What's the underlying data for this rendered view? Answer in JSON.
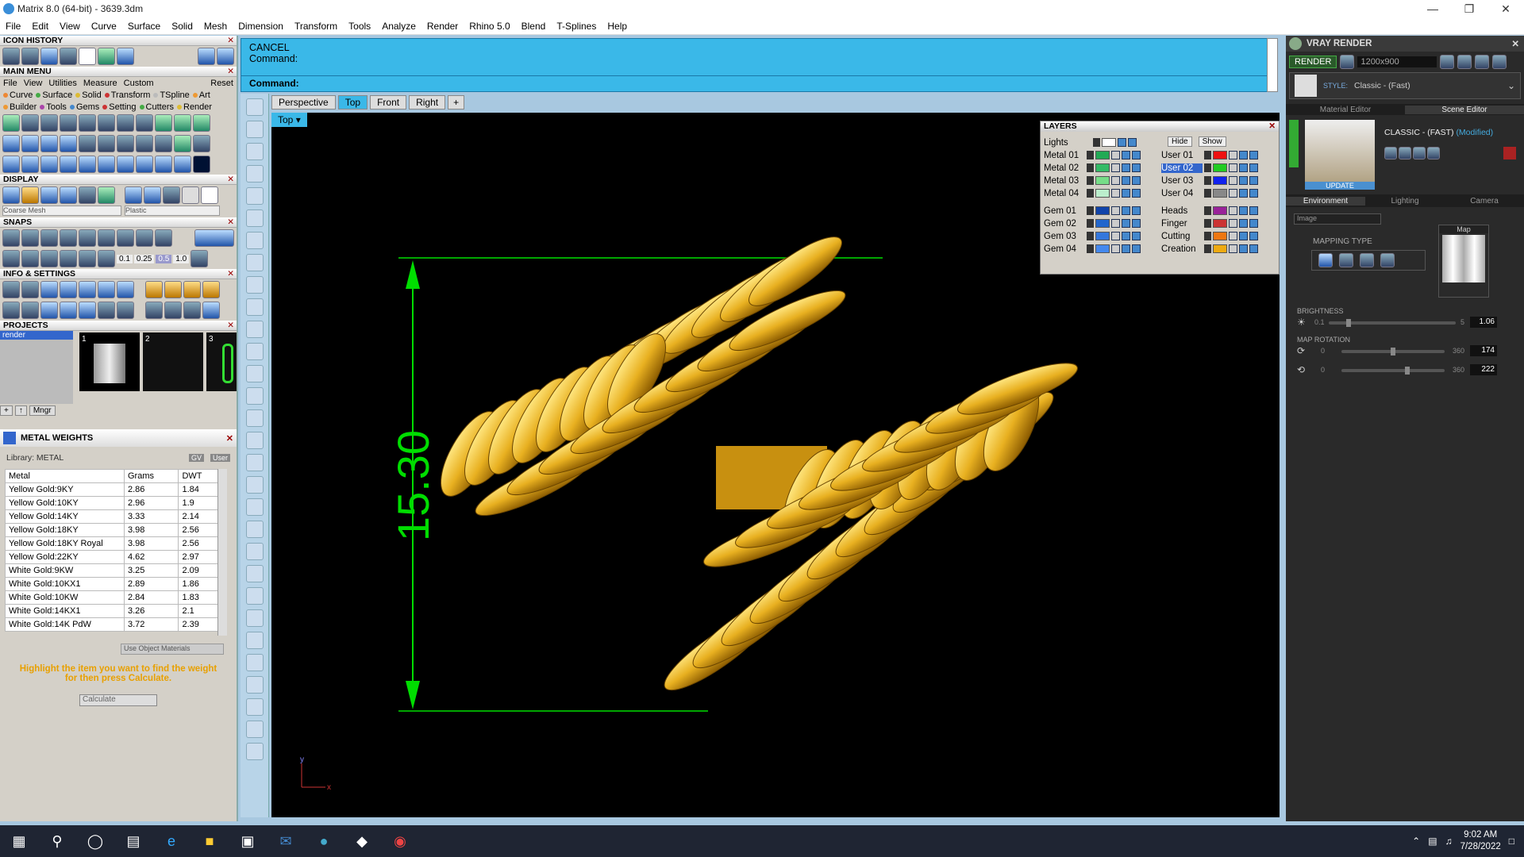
{
  "window": {
    "title": "Matrix 8.0 (64-bit) - 3639.3dm"
  },
  "menu": [
    "File",
    "Edit",
    "View",
    "Curve",
    "Surface",
    "Solid",
    "Mesh",
    "Dimension",
    "Transform",
    "Tools",
    "Analyze",
    "Render",
    "Rhino 5.0",
    "Blend",
    "T-Splines",
    "Help"
  ],
  "left": {
    "icon_history": "ICON HISTORY",
    "main_menu": "MAIN MENU",
    "mm_row1": [
      "File",
      "View",
      "Utilities",
      "Measure",
      "Custom",
      "Reset"
    ],
    "mm_row2": [
      "Curve",
      "Surface",
      "Solid",
      "Transform",
      "TSpline",
      "Art"
    ],
    "mm_row3": [
      "Builder",
      "Tools",
      "Gems",
      "Setting",
      "Cutters",
      "Render"
    ],
    "display": "DISPLAY",
    "display_left": "Coarse Mesh",
    "display_right": "Plastic",
    "snaps": "SNAPS",
    "snap_values": [
      "0.1",
      "0.25",
      "0.5",
      "1.0"
    ],
    "info": "INFO & SETTINGS",
    "projects": "PROJECTS",
    "project_item": "render",
    "project_nums": [
      "1",
      "2",
      "3"
    ],
    "mngr": "Mngr",
    "metal_weights": "METAL WEIGHTS",
    "library": "Library: METAL",
    "gv": "GV",
    "user": "User",
    "table_headers": [
      "Metal",
      "Grams",
      "DWT"
    ],
    "rows": [
      [
        "Yellow Gold:9KY",
        "2.86",
        "1.84"
      ],
      [
        "Yellow Gold:10KY",
        "2.96",
        "1.9"
      ],
      [
        "Yellow Gold:14KY",
        "3.33",
        "2.14"
      ],
      [
        "Yellow Gold:18KY",
        "3.98",
        "2.56"
      ],
      [
        "Yellow Gold:18KY Royal",
        "3.98",
        "2.56"
      ],
      [
        "Yellow Gold:22KY",
        "4.62",
        "2.97"
      ],
      [
        "White Gold:9KW",
        "3.25",
        "2.09"
      ],
      [
        "White Gold:10KX1",
        "2.89",
        "1.86"
      ],
      [
        "White Gold:10KW",
        "2.84",
        "1.83"
      ],
      [
        "White Gold:14KX1",
        "3.26",
        "2.1"
      ],
      [
        "White Gold:14K PdW",
        "3.72",
        "2.39"
      ]
    ],
    "use_object": "Use Object Materials",
    "hint": "Highlight the item you want to find the weight for then press Calculate.",
    "calculate": "Calculate"
  },
  "command": {
    "line1": "CANCEL",
    "line2": "Command:",
    "prompt": "Command:"
  },
  "view_tabs": [
    "Perspective",
    "Top",
    "Front",
    "Right"
  ],
  "view_label": "Top",
  "dimension": "15.30",
  "layers": {
    "title": "LAYERS",
    "lights": "Lights",
    "hide": "Hide",
    "show": "Show",
    "left": [
      {
        "name": "Metal 01",
        "color": "#22aa55"
      },
      {
        "name": "Metal 02",
        "color": "#33bb66"
      },
      {
        "name": "Metal 03",
        "color": "#77dd88"
      },
      {
        "name": "Metal 04",
        "color": "#bbeecc"
      },
      {
        "name": "Gem 01",
        "color": "#1144aa"
      },
      {
        "name": "Gem 02",
        "color": "#2266cc"
      },
      {
        "name": "Gem 03",
        "color": "#3377dd"
      },
      {
        "name": "Gem 04",
        "color": "#4488ee"
      }
    ],
    "right": [
      {
        "name": "User 01",
        "color": "#ee1111"
      },
      {
        "name": "User 02",
        "color": "#22cc22"
      },
      {
        "name": "User 03",
        "color": "#1122ee"
      },
      {
        "name": "User 04",
        "color": "#888888"
      },
      {
        "name": "Heads",
        "color": "#992299"
      },
      {
        "name": "Finger",
        "color": "#cc3333"
      },
      {
        "name": "Cutting",
        "color": "#ee7711"
      },
      {
        "name": "Creation",
        "color": "#eeaa11"
      }
    ]
  },
  "vray": {
    "title": "VRAY RENDER",
    "render": "RENDER",
    "resolution": "1200x900",
    "style_label": "STYLE:",
    "style": "Classic - (Fast)",
    "tabs": [
      "Material Editor",
      "Scene Editor"
    ],
    "preset": "CLASSIC - (FAST)",
    "modified": "(Modified)",
    "update": "UPDATE",
    "subtabs": [
      "Environment",
      "Lighting",
      "Camera"
    ],
    "image": "Image",
    "mapping": "MAPPING TYPE",
    "map": "Map",
    "brightness": "BRIGHTNESS",
    "b_min": "0.1",
    "b_max": "5",
    "b_val": "1.06",
    "map_rotation": "MAP ROTATION",
    "r_min": "0",
    "r_max": "360",
    "r1": "174",
    "r2": "222"
  },
  "taskbar": {
    "time": "9:02 AM",
    "date": "7/28/2022"
  },
  "colors": {
    "accent": "#3ab8e8",
    "dim": "#00dd00",
    "gold": "#e8b020"
  }
}
